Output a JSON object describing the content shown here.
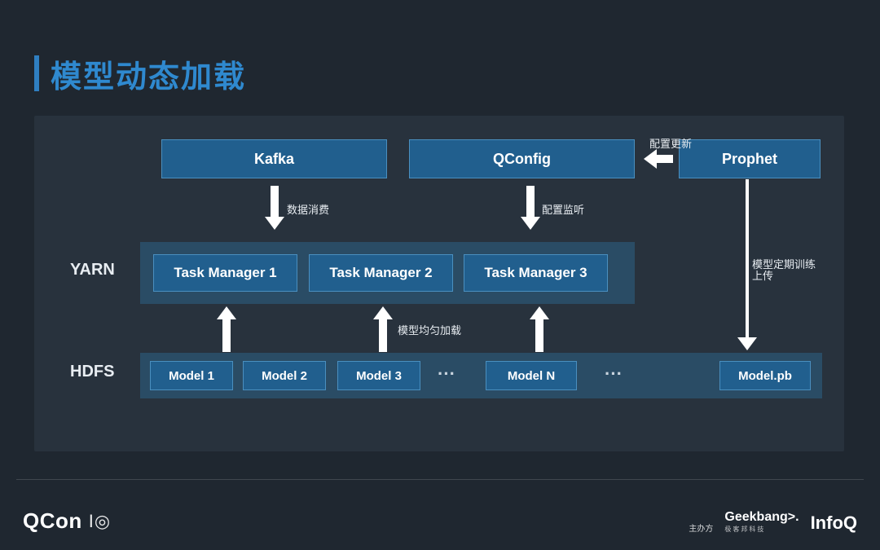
{
  "title": "模型动态加载",
  "top": {
    "kafka": "Kafka",
    "qconfig": "QConfig",
    "prophet": "Prophet"
  },
  "sections": {
    "yarn": "YARN",
    "hdfs": "HDFS"
  },
  "tasks": {
    "t1": "Task Manager 1",
    "t2": "Task Manager 2",
    "t3": "Task Manager 3"
  },
  "models": {
    "m1": "Model 1",
    "m2": "Model 2",
    "m3": "Model 3",
    "mn": "Model N",
    "mpb": "Model.pb"
  },
  "ellipsis": "···",
  "annotations": {
    "data_consume": "数据消费",
    "config_listen": "配置监听",
    "config_update": "配置更新",
    "model_balance_load": "模型均匀加载",
    "model_train_upload": "模型定期训练上传"
  },
  "footer": {
    "qcon": "QCon",
    "io": "I◎",
    "host_label": "主办方",
    "geekbang": "Geekbang>.",
    "geekbang_sub": "极客邦科技",
    "infoq": "InfoQ"
  }
}
